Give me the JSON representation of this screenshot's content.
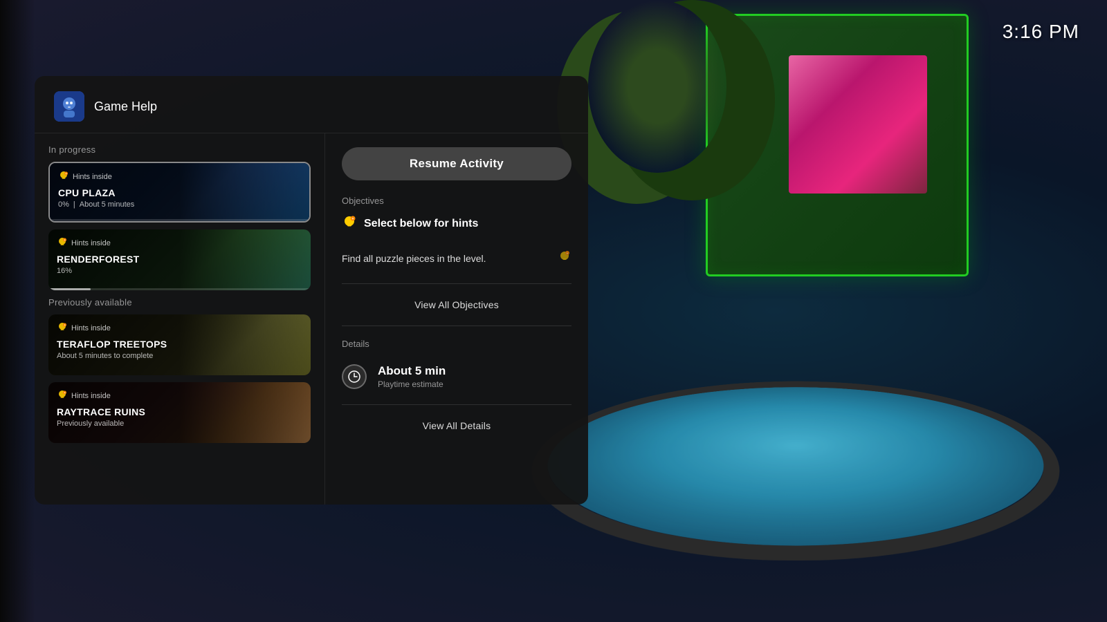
{
  "clock": "3:16 PM",
  "header": {
    "game_help_label": "Game Help",
    "game_icon_emoji": "🤖"
  },
  "resume_button": "Resume Activity",
  "sidebar": {
    "in_progress_label": "In progress",
    "previously_available_label": "Previously available",
    "in_progress_items": [
      {
        "hints_label": "Hints inside",
        "title": "CPU PLAZA",
        "progress_percent": "0%",
        "meta": "About 5 minutes",
        "meta_separator": "|",
        "progress_value": 0,
        "is_active": true
      },
      {
        "hints_label": "Hints inside",
        "title": "RENDERFOREST",
        "progress_percent": "16%",
        "meta": "",
        "progress_value": 16,
        "is_active": false
      }
    ],
    "previously_available_items": [
      {
        "hints_label": "Hints inside",
        "title": "TERAFLOP TREETOPS",
        "meta": "About 5 minutes to complete",
        "is_active": false
      },
      {
        "hints_label": "Hints inside",
        "title": "RAYTRACE RUINS",
        "meta": "Previously available",
        "is_active": false
      }
    ]
  },
  "objectives": {
    "section_label": "Objectives",
    "select_hints_text": "Select below for hints",
    "objective_text": "Find all puzzle pieces in the level.",
    "view_all_label": "View All Objectives"
  },
  "details": {
    "section_label": "Details",
    "playtime_value": "About 5 min",
    "playtime_label": "Playtime estimate",
    "view_all_label": "View All Details"
  }
}
